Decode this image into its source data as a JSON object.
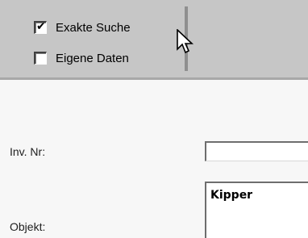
{
  "toolbar": {
    "exact_search": {
      "label": "Exakte Suche",
      "checked": true,
      "check_glyph": "✔"
    },
    "own_data": {
      "label": "Eigene Daten",
      "checked": false
    }
  },
  "form": {
    "inventory_number": {
      "label": "Inv. Nr:",
      "value": ""
    },
    "object": {
      "label": "Objekt:",
      "value": "Kipper"
    }
  },
  "icons": {
    "cursor": "mouse-pointer-arrow-icon"
  },
  "colors": {
    "toolbar_bg": "#c6c6c6",
    "page_bg": "#f7f7f7",
    "input_bg": "#ffffff"
  }
}
